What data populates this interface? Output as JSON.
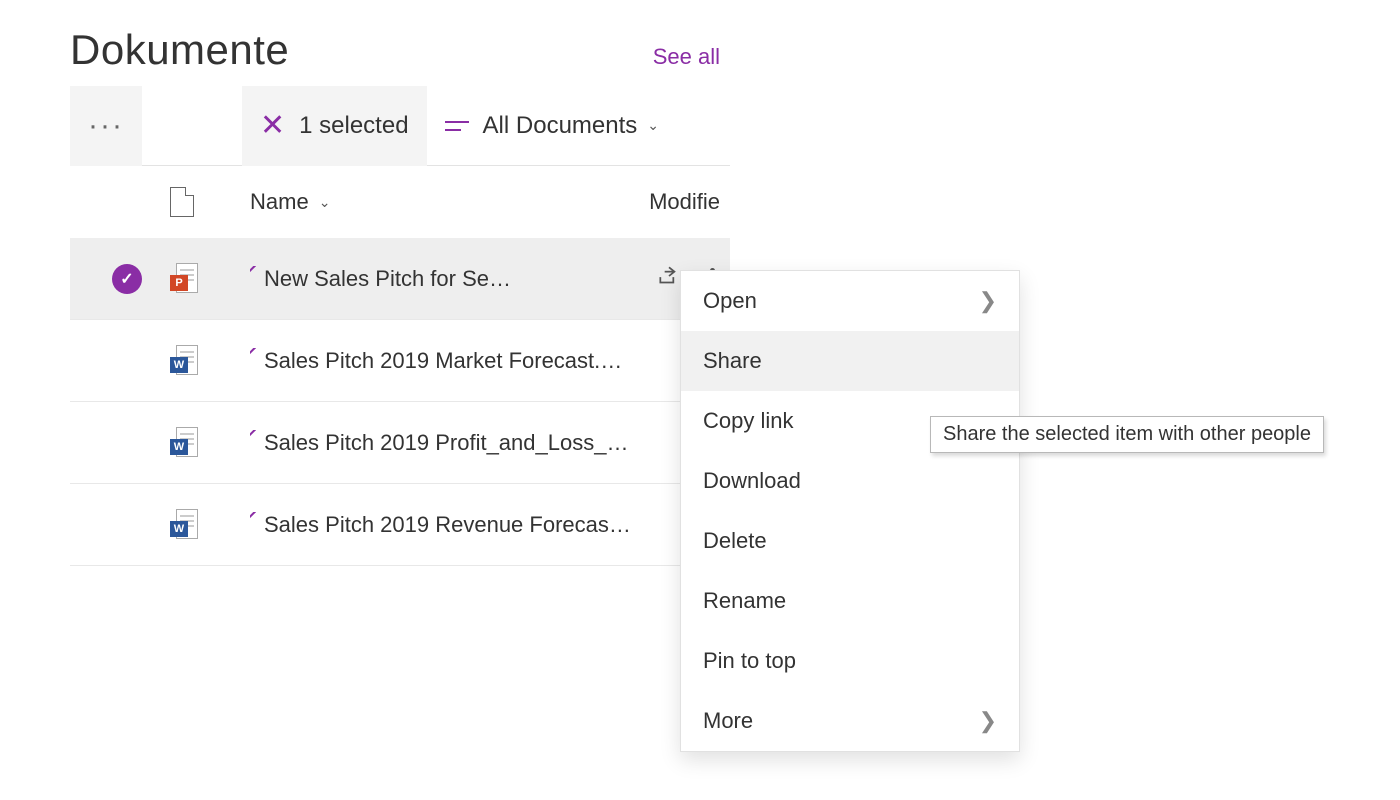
{
  "header": {
    "title": "Dokumente",
    "see_all": "See all"
  },
  "toolbar": {
    "selected_label": "1 selected",
    "view_label": "All Documents"
  },
  "columns": {
    "name": "Name",
    "modified": "Modifie"
  },
  "files": [
    {
      "name": "New Sales Pitch for Se…",
      "type": "ppt",
      "selected": true,
      "pinned": false
    },
    {
      "name": "Sales Pitch 2019 Market Forecast.…",
      "type": "wrd",
      "selected": false,
      "pinned": true
    },
    {
      "name": "Sales Pitch 2019 Profit_and_Loss_…",
      "type": "wrd",
      "selected": false,
      "pinned": true
    },
    {
      "name": "Sales Pitch 2019 Revenue Forecas…",
      "type": "wrd",
      "selected": false,
      "pinned": true
    }
  ],
  "menu": {
    "open": "Open",
    "share": "Share",
    "copy_link": "Copy link",
    "download": "Download",
    "delete": "Delete",
    "rename": "Rename",
    "pin": "Pin to top",
    "more": "More"
  },
  "tooltip": "Share the selected item with other people"
}
